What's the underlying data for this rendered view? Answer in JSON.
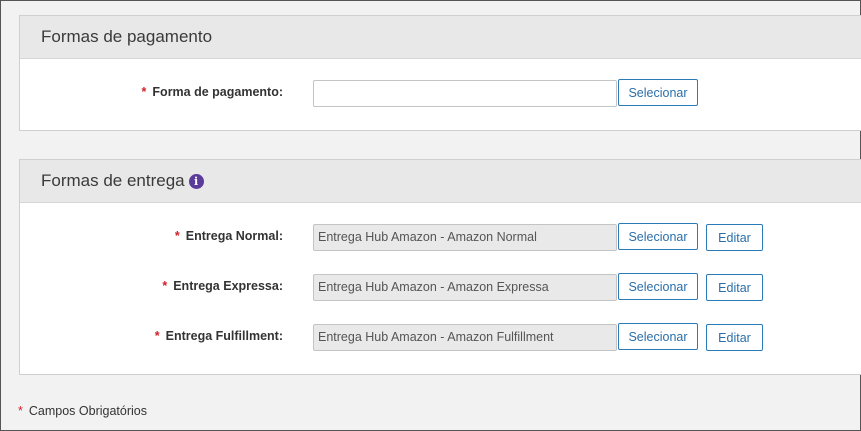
{
  "payment_panel": {
    "title": "Formas de pagamento",
    "fields": [
      {
        "required_marker": "*",
        "label": "Forma de pagamento:",
        "value": "",
        "select_label": "Selecionar"
      }
    ]
  },
  "delivery_panel": {
    "title": "Formas de entrega",
    "info_icon_glyph": "i",
    "fields": [
      {
        "required_marker": "*",
        "label": "Entrega Normal:",
        "value": "Entrega Hub Amazon - Amazon Normal",
        "select_label": "Selecionar",
        "edit_label": "Editar"
      },
      {
        "required_marker": "*",
        "label": "Entrega Expressa:",
        "value": "Entrega Hub Amazon - Amazon Expressa",
        "select_label": "Selecionar",
        "edit_label": "Editar"
      },
      {
        "required_marker": "*",
        "label": "Entrega Fulfillment:",
        "value": "Entrega Hub Amazon - Amazon Fulfillment",
        "select_label": "Selecionar",
        "edit_label": "Editar"
      }
    ]
  },
  "footer": {
    "required_marker": "*",
    "note": "Campos Obrigatórios"
  },
  "colors": {
    "required": "#d0202a",
    "button_border": "#2b7bb9",
    "button_text": "#2b6ea8",
    "info_icon": "#5a3a9a",
    "header_bg": "#e8e8e8"
  }
}
